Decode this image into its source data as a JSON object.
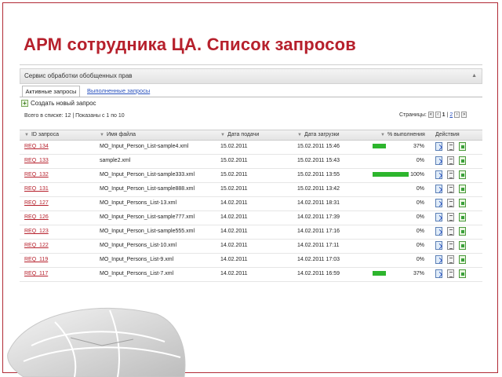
{
  "title": "АРМ сотрудника ЦА. Список запросов",
  "service_bar": {
    "label": "Сервис обработки обобщенных прав",
    "collapse": "▲"
  },
  "tabs": [
    {
      "label": "Активные запросы",
      "active": true
    },
    {
      "label": "Выполненные запросы",
      "active": false
    }
  ],
  "new_request": {
    "label": "Создать новый запрос",
    "icon": "plus-icon"
  },
  "summary": "Всего в списке: 12 | Показаны с 1 по 10",
  "pager": {
    "label": "Страницы:",
    "first": "«",
    "prev": "‹",
    "current": "1",
    "sep": "|",
    "next_page": "2",
    "next": "›",
    "last": "»"
  },
  "columns": [
    "ID запроса",
    "Имя файла",
    "Дата подачи",
    "Дата загрузки",
    "% выполнения",
    "Действия"
  ],
  "rows": [
    {
      "id": "REQ_134",
      "file": "MO_Input_Person_List-sample4.xml",
      "submitted": "15.02.2011",
      "loaded": "15.02.2011 15:46",
      "percent": 37,
      "percent_label": "37%"
    },
    {
      "id": "REQ_133",
      "file": "sample2.xml",
      "submitted": "15.02.2011",
      "loaded": "15.02.2011 15:43",
      "percent": 0,
      "percent_label": "0%"
    },
    {
      "id": "REQ_132",
      "file": "MO_Input_Person_List-sample333.xml",
      "submitted": "15.02.2011",
      "loaded": "15.02.2011 13:55",
      "percent": 100,
      "percent_label": "100%"
    },
    {
      "id": "REQ_131",
      "file": "MO_Input_Person_List-sample888.xml",
      "submitted": "15.02.2011",
      "loaded": "15.02.2011 13:42",
      "percent": 0,
      "percent_label": "0%"
    },
    {
      "id": "REQ_127",
      "file": "MO_Input_Persons_List-13.xml",
      "submitted": "14.02.2011",
      "loaded": "14.02.2011 18:31",
      "percent": 0,
      "percent_label": "0%"
    },
    {
      "id": "REQ_126",
      "file": "MO_Input_Person_List-sample777.xml",
      "submitted": "14.02.2011",
      "loaded": "14.02.2011 17:39",
      "percent": 0,
      "percent_label": "0%"
    },
    {
      "id": "REQ_123",
      "file": "MO_Input_Person_List-sample555.xml",
      "submitted": "14.02.2011",
      "loaded": "14.02.2011 17:16",
      "percent": 0,
      "percent_label": "0%"
    },
    {
      "id": "REQ_122",
      "file": "MO_Input_Persons_List-10.xml",
      "submitted": "14.02.2011",
      "loaded": "14.02.2011 17:11",
      "percent": 0,
      "percent_label": "0%"
    },
    {
      "id": "REQ_119",
      "file": "MO_Input_Persons_List-9.xml",
      "submitted": "14.02.2011",
      "loaded": "14.02.2011 17:03",
      "percent": 0,
      "percent_label": "0%"
    },
    {
      "id": "REQ_117",
      "file": "MO_Input_Persons_List-7.xml",
      "submitted": "14.02.2011",
      "loaded": "14.02.2011 16:59",
      "percent": 37,
      "percent_label": "37%"
    }
  ],
  "actions": [
    "open-icon",
    "document-icon",
    "download-icon"
  ],
  "colors": {
    "title": "#b6202c",
    "link": "#2a52be",
    "progress": "#2db52d",
    "frame": "#b12a35"
  }
}
